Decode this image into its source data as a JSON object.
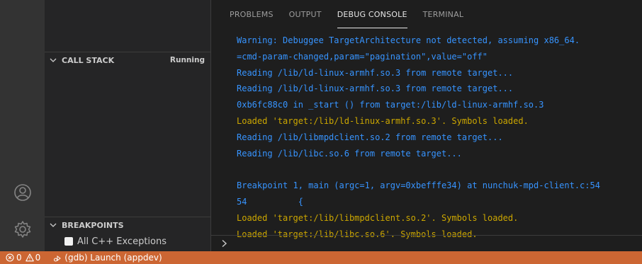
{
  "sidebar": {
    "call_stack": {
      "title": "CALL STACK",
      "status": "Running"
    },
    "breakpoints": {
      "title": "BREAKPOINTS",
      "items": [
        {
          "label": "All C++ Exceptions",
          "checked": true
        }
      ]
    }
  },
  "panel": {
    "tabs": [
      {
        "label": "PROBLEMS",
        "active": false
      },
      {
        "label": "OUTPUT",
        "active": false
      },
      {
        "label": "DEBUG CONSOLE",
        "active": true
      },
      {
        "label": "TERMINAL",
        "active": false
      }
    ],
    "console_lines": [
      {
        "text": "Warning: Debuggee TargetArchitecture not detected, assuming x86_64.",
        "color": "blue"
      },
      {
        "text": "=cmd-param-changed,param=\"pagination\",value=\"off\"",
        "color": "blue"
      },
      {
        "text": "Reading /lib/ld-linux-armhf.so.3 from remote target...",
        "color": "blue"
      },
      {
        "text": "Reading /lib/ld-linux-armhf.so.3 from remote target...",
        "color": "blue"
      },
      {
        "text": "0xb6fc88c0 in _start () from target:/lib/ld-linux-armhf.so.3",
        "color": "blue"
      },
      {
        "text": "Loaded 'target:/lib/ld-linux-armhf.so.3'. Symbols loaded.",
        "color": "yellow"
      },
      {
        "text": "Reading /lib/libmpdclient.so.2 from remote target...",
        "color": "blue"
      },
      {
        "text": "Reading /lib/libc.so.6 from remote target...",
        "color": "blue"
      },
      {
        "text": "",
        "color": "blue"
      },
      {
        "text": "Breakpoint 1, main (argc=1, argv=0xbefffe34) at nunchuk-mpd-client.c:54",
        "color": "blue"
      },
      {
        "text": "54\t    {",
        "color": "blue"
      },
      {
        "text": "Loaded 'target:/lib/libmpdclient.so.2'. Symbols loaded.",
        "color": "yellow"
      },
      {
        "text": "Loaded 'target:/lib/libc.so.6'. Symbols loaded.",
        "color": "yellow"
      }
    ],
    "prompt_icon": "chevron-right-icon"
  },
  "statusbar": {
    "errors": "0",
    "warnings": "0",
    "debug_config": "(gdb) Launch (appdev)",
    "background": "#cc6633"
  },
  "colors": {
    "blue": "#3794ff",
    "yellow": "#cca700"
  }
}
